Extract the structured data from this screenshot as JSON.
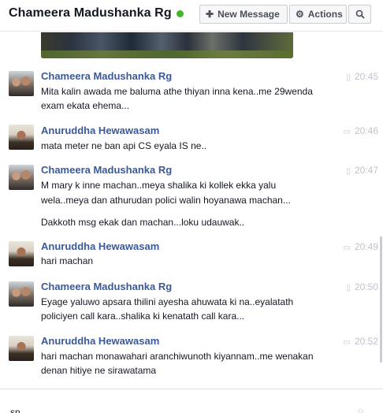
{
  "header": {
    "title": "Chameera Madushanka Rg",
    "new_message_label": "New Message",
    "actions_label": "Actions",
    "status_color": "#42b72a"
  },
  "icons": {
    "new_message": "plus-icon",
    "actions": "gear-icon",
    "search": "search-icon",
    "mobile": "mobile-phone-icon",
    "web": "chat-bubble-icon"
  },
  "messages": [
    {
      "sender": "Chameera Madushanka Rg",
      "time": "20:45",
      "via": "mobile",
      "lines": [
        "Mita kalin awada me baluma athe thiyan inna kena..me 29wenda",
        "exam ekata ehema..."
      ]
    },
    {
      "sender": "Anuruddha Hewawasam",
      "time": "20:46",
      "via": "web",
      "lines": [
        "mata meter ne ban api CS eyala IS ne.."
      ]
    },
    {
      "sender": "Chameera Madushanka Rg",
      "time": "20:47",
      "via": "mobile",
      "lines": [
        "M mary k inne machan..meya shalika ki kollek ekka yalu",
        "wela..meya dan athurudan polici walin hoyanawa machan...",
        "Dakkoth msg ekak dan machan...loku udauwak.."
      ]
    },
    {
      "sender": "Anuruddha Hewawasam",
      "time": "20:49",
      "via": "web",
      "lines": [
        "hari machan"
      ]
    },
    {
      "sender": "Chameera Madushanka Rg",
      "time": "20:50",
      "via": "mobile",
      "lines": [
        "Eyage yaluwo apsara thilini ayesha ahuwata ki na..eyalatath",
        "policiyen call kara..shalika ki kenatath call kara..."
      ]
    },
    {
      "sender": "Anuruddha Hewawasam",
      "time": "20:52",
      "via": "web",
      "lines": [
        "hari machan monawahari aranchiwunoth kiyannam..me wenakan",
        "denan hitiye ne sirawatama"
      ]
    }
  ],
  "composer": {
    "value": "sn"
  }
}
